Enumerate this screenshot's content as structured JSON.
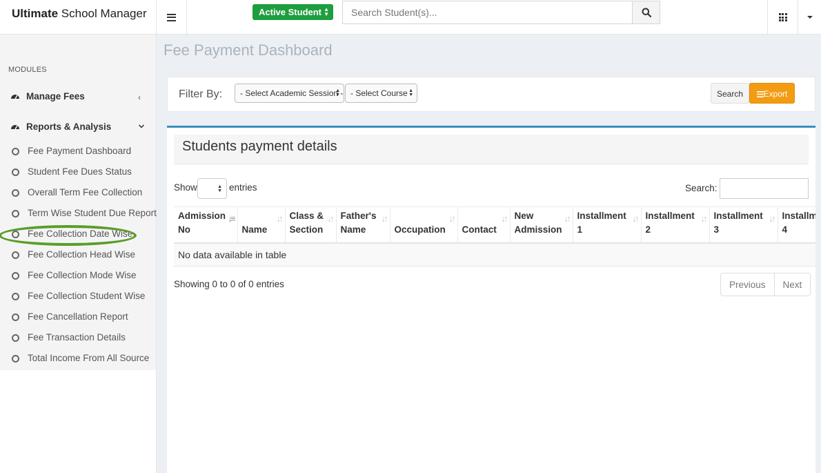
{
  "app": {
    "brand_bold": "Ultimate",
    "brand_rest": " School Manager"
  },
  "header": {
    "active_student_label": "Active Student",
    "search_placeholder": "Search Student(s)..."
  },
  "sidebar": {
    "section_title": "MODULES",
    "groups": [
      {
        "label": "Manage Fees",
        "chevron": "‹"
      },
      {
        "label": "Reports & Analysis",
        "chevron": "⌄"
      }
    ],
    "items": [
      {
        "label": "Fee Payment Dashboard"
      },
      {
        "label": "Student Fee Dues Status"
      },
      {
        "label": "Overall Term Fee Collection"
      },
      {
        "label": "Term Wise Student Due Report"
      },
      {
        "label": "Fee Collection Date Wise",
        "highlighted": true
      },
      {
        "label": "Fee Collection Head Wise"
      },
      {
        "label": "Fee Collection Mode Wise"
      },
      {
        "label": "Fee Collection Student Wise"
      },
      {
        "label": "Fee Cancellation Report"
      },
      {
        "label": "Fee Transaction Details"
      },
      {
        "label": "Total Income From All Source"
      }
    ],
    "highlight_color": "#5a9e2a"
  },
  "page": {
    "title": "Fee Payment Dashboard"
  },
  "filter": {
    "label": "Filter By:",
    "session_select": "- Select Academic Session -",
    "course_select": "- Select Course -",
    "search_button": "Search",
    "export_button": "Export"
  },
  "table_box": {
    "title": "Students payment details",
    "show_label": "Show",
    "entries_label": "entries",
    "search_label": "Search:",
    "columns": [
      {
        "line1": "Admission",
        "line2": "No"
      },
      {
        "line1": "",
        "line2": "Name"
      },
      {
        "line1": "Class &",
        "line2": "Section"
      },
      {
        "line1": "Father's",
        "line2": "Name"
      },
      {
        "line1": "",
        "line2": "Occupation"
      },
      {
        "line1": "",
        "line2": "Contact"
      },
      {
        "line1": "New",
        "line2": "Admission"
      },
      {
        "line1": "Installment",
        "line2": "1"
      },
      {
        "line1": "Installment",
        "line2": "2"
      },
      {
        "line1": "Installment",
        "line2": "3"
      },
      {
        "line1": "Installment",
        "line2": "4"
      }
    ],
    "empty_message": "No data available in table",
    "info": "Showing 0 to 0 of 0 entries",
    "prev_label": "Previous",
    "next_label": "Next"
  },
  "colors": {
    "accent": "#3c8dbc",
    "success": "#1e9e3e",
    "warning": "#f39c12"
  }
}
